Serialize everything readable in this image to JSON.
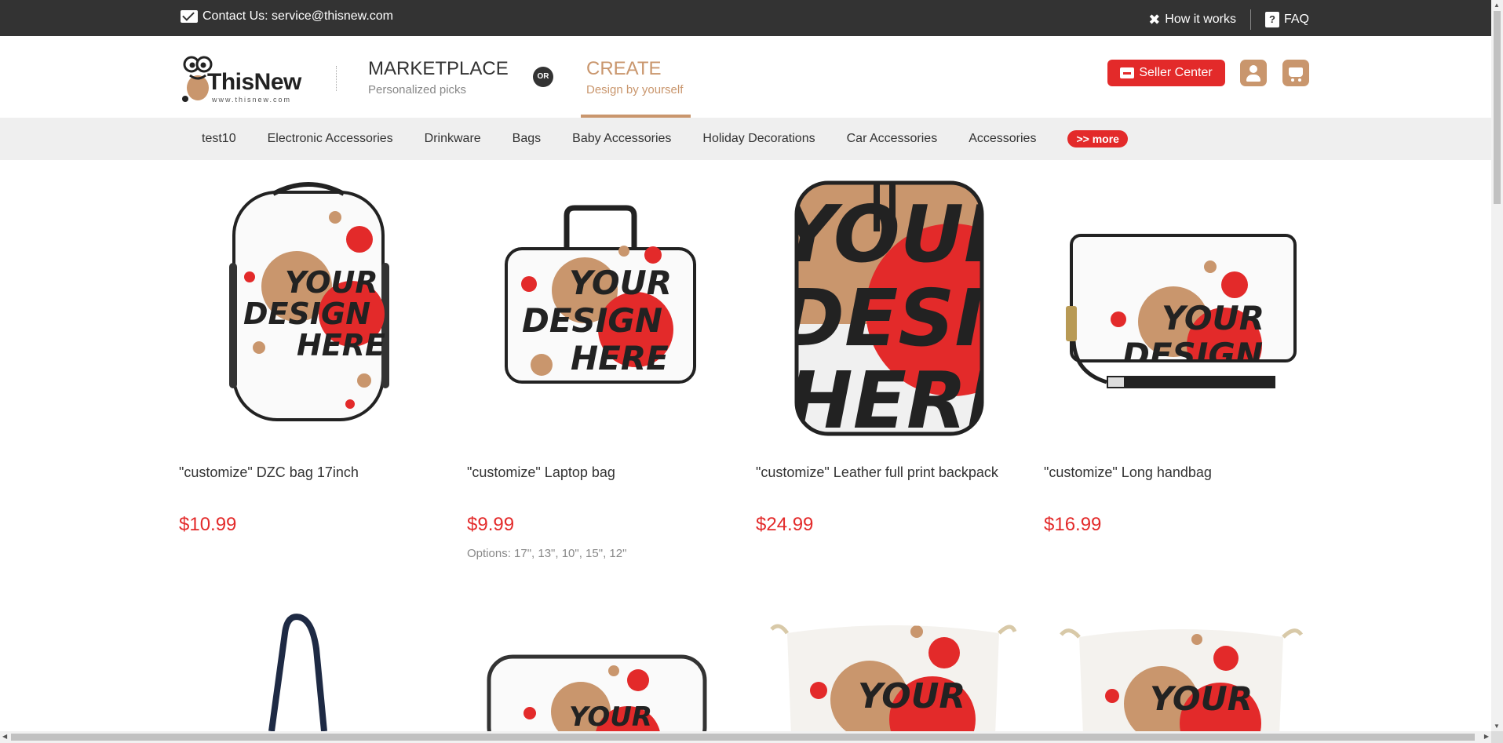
{
  "topbar": {
    "contact_text": "Contact Us: service@thisnew.com",
    "how_it_works": "How it works",
    "faq": "FAQ"
  },
  "header": {
    "logo_name": "ThisNew",
    "logo_url": "www.thisnew.com",
    "marketplace_title": "MARKETPLACE",
    "marketplace_sub": "Personalized picks",
    "or_label": "OR",
    "create_title": "CREATE",
    "create_sub": "Design by yourself",
    "seller_center": "Seller Center"
  },
  "nav": {
    "items": [
      "test10",
      "Electronic Accessories",
      "Drinkware",
      "Bags",
      "Baby Accessories",
      "Holiday Decorations",
      "Car Accessories",
      "Accessories"
    ],
    "more": ">> more"
  },
  "products": [
    {
      "title": "\"customize\" DZC bag 17inch",
      "price": "$10.99",
      "options": ""
    },
    {
      "title": "\"customize\" Laptop bag",
      "price": "$9.99",
      "options": "Options: 17\", 13\", 10\", 15\", 12\""
    },
    {
      "title": "\"customize\" Leather full print backpack",
      "price": "$24.99",
      "options": ""
    },
    {
      "title": "\"customize\" Long handbag",
      "price": "$16.99",
      "options": ""
    }
  ],
  "design_text": [
    "YOUR",
    "DESIGN",
    "HERE"
  ],
  "colors": {
    "accent_red": "#e32a2a",
    "brand_tan": "#c9966d",
    "topbar_bg": "#333333",
    "nav_bg": "#efefef"
  }
}
